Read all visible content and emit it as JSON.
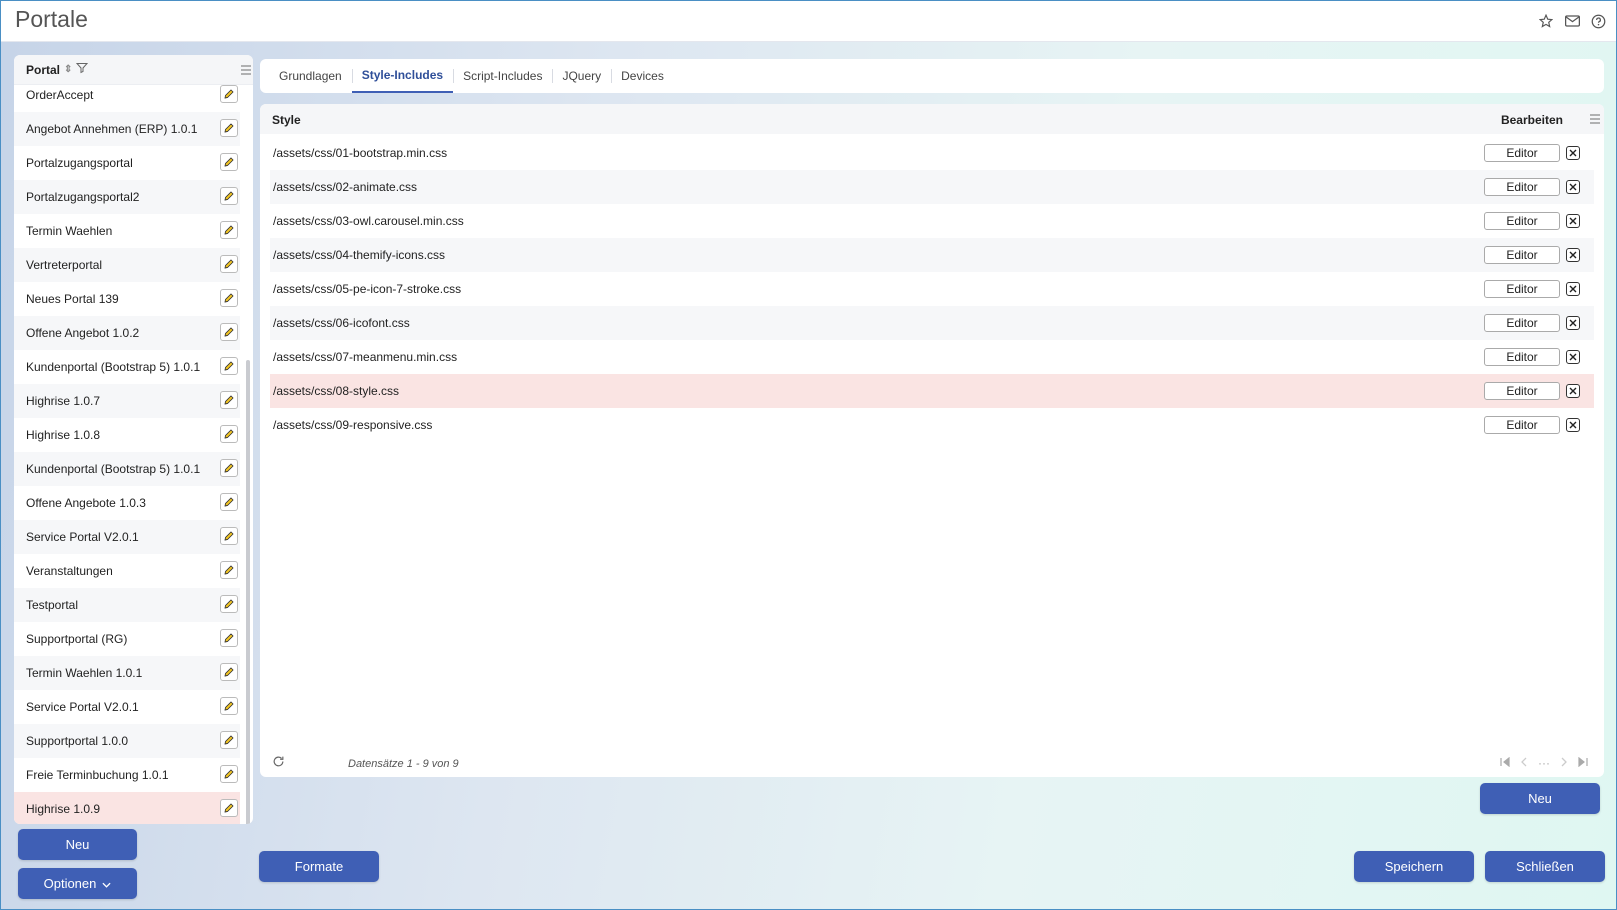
{
  "app": {
    "title": "Portale"
  },
  "header_icons": [
    "star-icon",
    "mail-icon",
    "help-icon"
  ],
  "sidebar": {
    "header": "Portal",
    "items": [
      {
        "label": "OrderAccept"
      },
      {
        "label": "Angebot Annehmen (ERP) 1.0.1"
      },
      {
        "label": "Portalzugangsportal"
      },
      {
        "label": "Portalzugangsportal2"
      },
      {
        "label": "Termin Waehlen"
      },
      {
        "label": "Vertreterportal"
      },
      {
        "label": "Neues Portal 139"
      },
      {
        "label": "Offene Angebot 1.0.2"
      },
      {
        "label": "Kundenportal (Bootstrap 5) 1.0.1"
      },
      {
        "label": "Highrise 1.0.7"
      },
      {
        "label": "Highrise 1.0.8"
      },
      {
        "label": "Kundenportal (Bootstrap 5) 1.0.1"
      },
      {
        "label": "Offene Angebote 1.0.3"
      },
      {
        "label": "Service Portal V2.0.1"
      },
      {
        "label": "Veranstaltungen"
      },
      {
        "label": "Testportal"
      },
      {
        "label": "Supportportal (RG)"
      },
      {
        "label": "Termin Waehlen 1.0.1"
      },
      {
        "label": "Service Portal V2.0.1"
      },
      {
        "label": "Supportportal 1.0.0"
      },
      {
        "label": "Freie Terminbuchung 1.0.1"
      },
      {
        "label": "Highrise 1.0.9",
        "selected": true
      }
    ],
    "new_label": "Neu",
    "options_label": "Optionen"
  },
  "tabs": [
    {
      "label": "Grundlagen"
    },
    {
      "label": "Style-Includes",
      "active": true
    },
    {
      "label": "Script-Includes"
    },
    {
      "label": "JQuery"
    },
    {
      "label": "Devices"
    }
  ],
  "grid": {
    "col_style": "Style",
    "col_edit": "Bearbeiten",
    "editor_label": "Editor",
    "rows": [
      {
        "style": "/assets/css/01-bootstrap.min.css"
      },
      {
        "style": "/assets/css/02-animate.css"
      },
      {
        "style": "/assets/css/03-owl.carousel.min.css"
      },
      {
        "style": "/assets/css/04-themify-icons.css"
      },
      {
        "style": "/assets/css/05-pe-icon-7-stroke.css"
      },
      {
        "style": "/assets/css/06-icofont.css"
      },
      {
        "style": "/assets/css/07-meanmenu.min.css"
      },
      {
        "style": "/assets/css/08-style.css",
        "selected": true
      },
      {
        "style": "/assets/css/09-responsive.css"
      }
    ],
    "records": "Datensätze 1 - 9 von 9",
    "pager_ellipsis": "···"
  },
  "actions": {
    "grid_new": "Neu",
    "formats": "Formate",
    "save": "Speichern",
    "close": "Schließen"
  },
  "colors": {
    "accent": "#3f5fb5",
    "selected_row": "#fae4e3"
  }
}
